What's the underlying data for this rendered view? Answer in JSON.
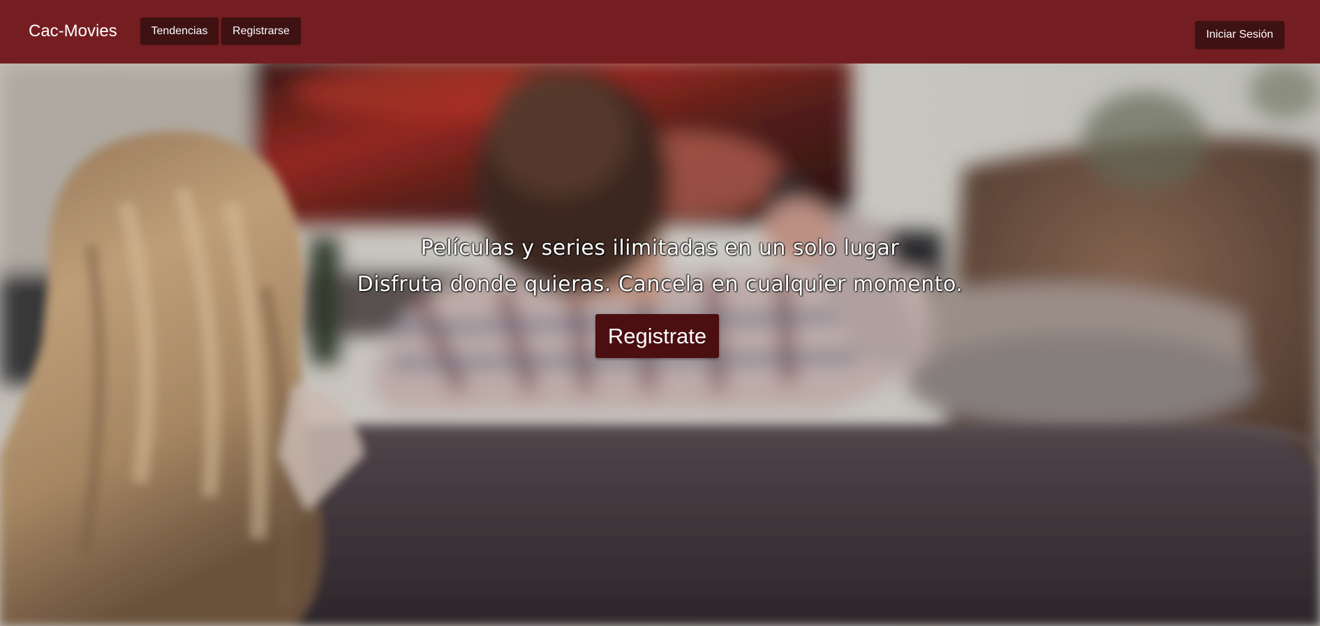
{
  "header": {
    "brand": "Cac-Movies",
    "nav": {
      "trending_label": "Tendencias",
      "register_label": "Registrarse"
    },
    "login_label": "Iniciar Sesión"
  },
  "hero": {
    "title": "Películas y series ilimitadas en un solo lugar",
    "subtitle": "Disfruta donde quieras. Cancela en cualquier momento.",
    "cta_label": "Registrate"
  },
  "colors": {
    "header_bg": "#751e21",
    "nav_button_bg": "#3e1113",
    "cta_bg": "#4b0e11",
    "text": "#ffffff"
  }
}
